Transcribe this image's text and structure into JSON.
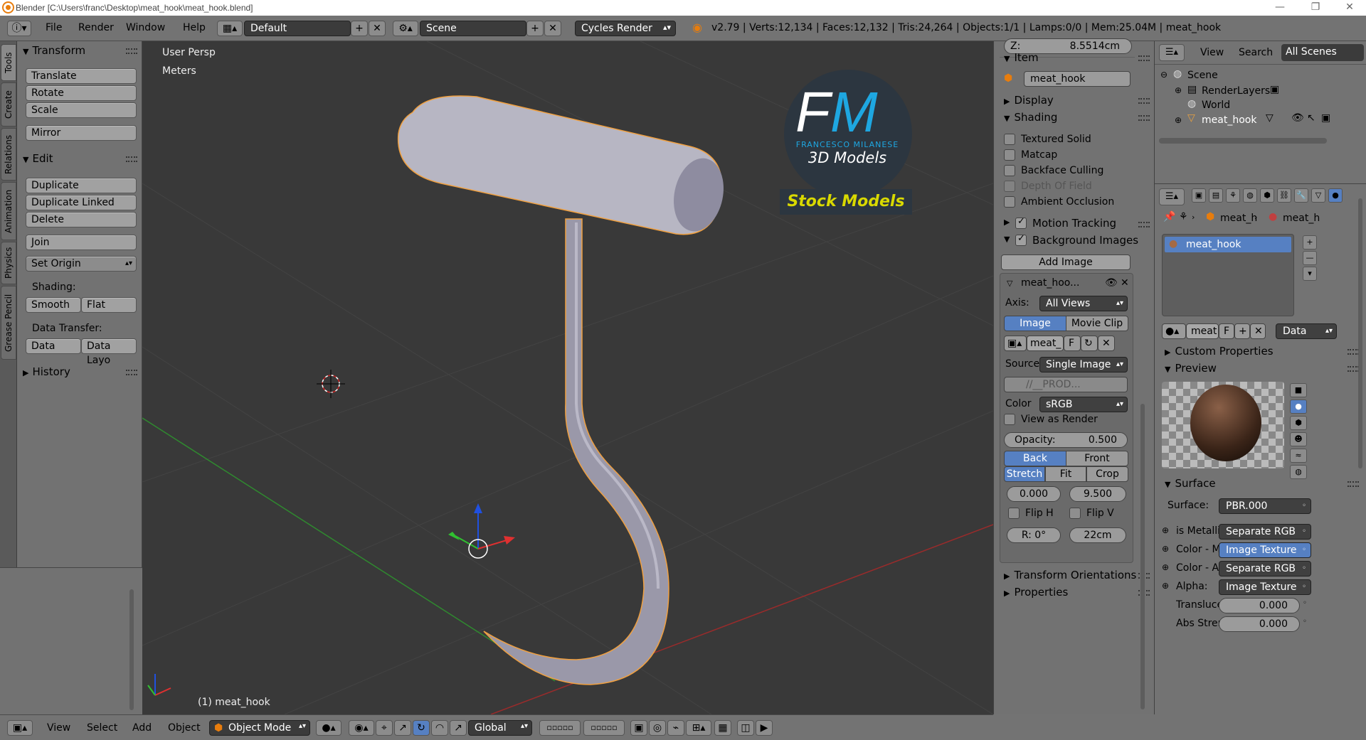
{
  "window": {
    "title": "Blender [C:\\Users\\franc\\Desktop\\meat_hook\\meat_hook.blend]",
    "minimize": "—",
    "maximize": "❐",
    "close": "✕"
  },
  "topbar": {
    "menus": [
      "File",
      "Render",
      "Window",
      "Help"
    ],
    "screen_layout": "Default",
    "scene": "Scene",
    "render_engine": "Cycles Render",
    "stats": "v2.79 | Verts:12,134 | Faces:12,132 | Tris:24,264 | Objects:1/1 | Lamps:0/0 | Mem:25.04M | meat_hook"
  },
  "left_tabs": [
    "Tools",
    "Create",
    "Relations",
    "Animation",
    "Physics",
    "Grease Pencil"
  ],
  "toolshelf": {
    "transform_header": "Transform",
    "translate": "Translate",
    "rotate": "Rotate",
    "scale": "Scale",
    "mirror": "Mirror",
    "edit_header": "Edit",
    "duplicate": "Duplicate",
    "duplicate_linked": "Duplicate Linked",
    "delete": "Delete",
    "join": "Join",
    "set_origin": "Set Origin",
    "shading_label": "Shading:",
    "smooth": "Smooth",
    "flat": "Flat",
    "data_transfer_label": "Data Transfer:",
    "data": "Data",
    "data_layout": "Data Layo",
    "history_header": "History"
  },
  "viewport": {
    "view_name": "User Persp",
    "units": "Meters",
    "active_object": "(1) meat_hook",
    "watermark": {
      "logo_text": "FM",
      "author": "FRANCESCO MILANESE",
      "sub": "3D Models",
      "banner": "Stock Models"
    }
  },
  "npanel": {
    "z_label": "Z:",
    "z_value": "8.5514cm",
    "item_header": "Item",
    "item_name": "meat_hook",
    "display_header": "Display",
    "shading_header": "Shading",
    "shading_options": [
      {
        "label": "Textured Solid",
        "checked": false
      },
      {
        "label": "Matcap",
        "checked": false
      },
      {
        "label": "Backface Culling",
        "checked": false
      },
      {
        "label": "Depth Of Field",
        "checked": false
      },
      {
        "label": "Ambient Occlusion",
        "checked": false
      }
    ],
    "motion_tracking": "Motion Tracking",
    "background_images": "Background Images",
    "add_image": "Add Image",
    "bg_item_name": "meat_hoo...",
    "axis_label": "Axis:",
    "axis_value": "All Views",
    "image_tab": "Image",
    "movie_clip_tab": "Movie Clip",
    "img_block_name": "meat_",
    "img_block_f": "F",
    "source_label": "Source",
    "source_value": "Single Image",
    "filepath": "//__PROD...",
    "color_label": "Color",
    "color_value": "sRGB",
    "view_as_render": "View as Render",
    "opacity_label": "Opacity:",
    "opacity_value": "0.500",
    "back": "Back",
    "front": "Front",
    "stretch": "Stretch",
    "fit": "Fit",
    "crop": "Crop",
    "offset_x": "0.000",
    "offset_y": "9.500",
    "flip_h": "Flip H",
    "flip_v": "Flip V",
    "rotation": "R: 0°",
    "size": "22cm",
    "transform_orientations": "Transform Orientations",
    "properties": "Properties"
  },
  "outliner": {
    "menu_view": "View",
    "menu_search": "Search",
    "scope": "All Scenes",
    "rows": [
      "Scene",
      "RenderLayers",
      "World",
      "meat_hook"
    ]
  },
  "properties": {
    "breadcrumb_object": "meat_h",
    "breadcrumb_material": "meat_h",
    "material_slot": "meat_hook",
    "mat_name": "meat",
    "mat_f": "F",
    "link_mode": "Data",
    "custom_properties": "Custom Properties",
    "preview": "Preview",
    "surface_header": "Surface",
    "surface_label": "Surface:",
    "surface_value": "PBR.000",
    "inputs": [
      {
        "label": "is Metallic",
        "value": "Separate RGB"
      },
      {
        "label": "Color - Ma",
        "value": "Image Texture"
      },
      {
        "label": "Color - Ab",
        "value": "Separate RGB"
      },
      {
        "label": "Alpha:",
        "value": "Image Texture"
      }
    ],
    "translucency_label": "Transluce",
    "translucency_value": "0.000",
    "abs_strength_label": "Abs Stren",
    "abs_strength_value": "0.000"
  },
  "bottombar": {
    "menus": [
      "View",
      "Select",
      "Add",
      "Object"
    ],
    "mode": "Object Mode",
    "orientation": "Global"
  },
  "colors": {
    "accent_blue": "#5680c2",
    "panel_gray": "#727272",
    "viewport_bg": "#393939",
    "selection_orange": "#f0a040",
    "watermark_cyan": "#1ea7e1",
    "watermark_yellow": "#d9d900"
  }
}
